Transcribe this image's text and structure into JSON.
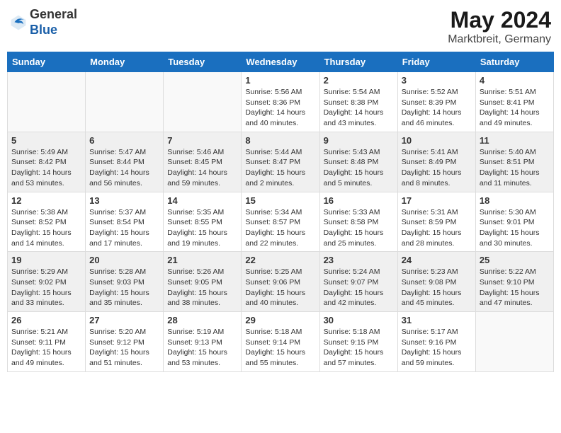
{
  "header": {
    "logo_line1": "General",
    "logo_line2": "Blue",
    "month_year": "May 2024",
    "location": "Marktbreit, Germany"
  },
  "days_of_week": [
    "Sunday",
    "Monday",
    "Tuesday",
    "Wednesday",
    "Thursday",
    "Friday",
    "Saturday"
  ],
  "weeks": [
    [
      {
        "date": "",
        "info": ""
      },
      {
        "date": "",
        "info": ""
      },
      {
        "date": "",
        "info": ""
      },
      {
        "date": "1",
        "info": "Sunrise: 5:56 AM\nSunset: 8:36 PM\nDaylight: 14 hours\nand 40 minutes."
      },
      {
        "date": "2",
        "info": "Sunrise: 5:54 AM\nSunset: 8:38 PM\nDaylight: 14 hours\nand 43 minutes."
      },
      {
        "date": "3",
        "info": "Sunrise: 5:52 AM\nSunset: 8:39 PM\nDaylight: 14 hours\nand 46 minutes."
      },
      {
        "date": "4",
        "info": "Sunrise: 5:51 AM\nSunset: 8:41 PM\nDaylight: 14 hours\nand 49 minutes."
      }
    ],
    [
      {
        "date": "5",
        "info": "Sunrise: 5:49 AM\nSunset: 8:42 PM\nDaylight: 14 hours\nand 53 minutes."
      },
      {
        "date": "6",
        "info": "Sunrise: 5:47 AM\nSunset: 8:44 PM\nDaylight: 14 hours\nand 56 minutes."
      },
      {
        "date": "7",
        "info": "Sunrise: 5:46 AM\nSunset: 8:45 PM\nDaylight: 14 hours\nand 59 minutes."
      },
      {
        "date": "8",
        "info": "Sunrise: 5:44 AM\nSunset: 8:47 PM\nDaylight: 15 hours\nand 2 minutes."
      },
      {
        "date": "9",
        "info": "Sunrise: 5:43 AM\nSunset: 8:48 PM\nDaylight: 15 hours\nand 5 minutes."
      },
      {
        "date": "10",
        "info": "Sunrise: 5:41 AM\nSunset: 8:49 PM\nDaylight: 15 hours\nand 8 minutes."
      },
      {
        "date": "11",
        "info": "Sunrise: 5:40 AM\nSunset: 8:51 PM\nDaylight: 15 hours\nand 11 minutes."
      }
    ],
    [
      {
        "date": "12",
        "info": "Sunrise: 5:38 AM\nSunset: 8:52 PM\nDaylight: 15 hours\nand 14 minutes."
      },
      {
        "date": "13",
        "info": "Sunrise: 5:37 AM\nSunset: 8:54 PM\nDaylight: 15 hours\nand 17 minutes."
      },
      {
        "date": "14",
        "info": "Sunrise: 5:35 AM\nSunset: 8:55 PM\nDaylight: 15 hours\nand 19 minutes."
      },
      {
        "date": "15",
        "info": "Sunrise: 5:34 AM\nSunset: 8:57 PM\nDaylight: 15 hours\nand 22 minutes."
      },
      {
        "date": "16",
        "info": "Sunrise: 5:33 AM\nSunset: 8:58 PM\nDaylight: 15 hours\nand 25 minutes."
      },
      {
        "date": "17",
        "info": "Sunrise: 5:31 AM\nSunset: 8:59 PM\nDaylight: 15 hours\nand 28 minutes."
      },
      {
        "date": "18",
        "info": "Sunrise: 5:30 AM\nSunset: 9:01 PM\nDaylight: 15 hours\nand 30 minutes."
      }
    ],
    [
      {
        "date": "19",
        "info": "Sunrise: 5:29 AM\nSunset: 9:02 PM\nDaylight: 15 hours\nand 33 minutes."
      },
      {
        "date": "20",
        "info": "Sunrise: 5:28 AM\nSunset: 9:03 PM\nDaylight: 15 hours\nand 35 minutes."
      },
      {
        "date": "21",
        "info": "Sunrise: 5:26 AM\nSunset: 9:05 PM\nDaylight: 15 hours\nand 38 minutes."
      },
      {
        "date": "22",
        "info": "Sunrise: 5:25 AM\nSunset: 9:06 PM\nDaylight: 15 hours\nand 40 minutes."
      },
      {
        "date": "23",
        "info": "Sunrise: 5:24 AM\nSunset: 9:07 PM\nDaylight: 15 hours\nand 42 minutes."
      },
      {
        "date": "24",
        "info": "Sunrise: 5:23 AM\nSunset: 9:08 PM\nDaylight: 15 hours\nand 45 minutes."
      },
      {
        "date": "25",
        "info": "Sunrise: 5:22 AM\nSunset: 9:10 PM\nDaylight: 15 hours\nand 47 minutes."
      }
    ],
    [
      {
        "date": "26",
        "info": "Sunrise: 5:21 AM\nSunset: 9:11 PM\nDaylight: 15 hours\nand 49 minutes."
      },
      {
        "date": "27",
        "info": "Sunrise: 5:20 AM\nSunset: 9:12 PM\nDaylight: 15 hours\nand 51 minutes."
      },
      {
        "date": "28",
        "info": "Sunrise: 5:19 AM\nSunset: 9:13 PM\nDaylight: 15 hours\nand 53 minutes."
      },
      {
        "date": "29",
        "info": "Sunrise: 5:18 AM\nSunset: 9:14 PM\nDaylight: 15 hours\nand 55 minutes."
      },
      {
        "date": "30",
        "info": "Sunrise: 5:18 AM\nSunset: 9:15 PM\nDaylight: 15 hours\nand 57 minutes."
      },
      {
        "date": "31",
        "info": "Sunrise: 5:17 AM\nSunset: 9:16 PM\nDaylight: 15 hours\nand 59 minutes."
      },
      {
        "date": "",
        "info": ""
      }
    ]
  ]
}
